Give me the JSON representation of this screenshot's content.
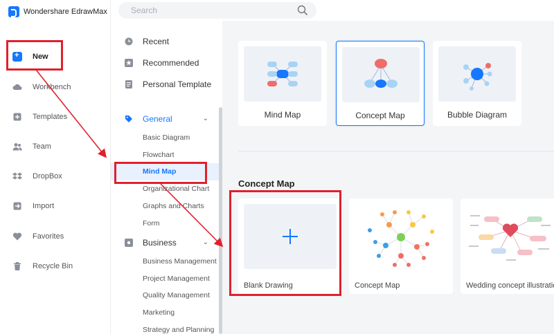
{
  "app": {
    "title": "Wondershare EdrawMax"
  },
  "search": {
    "placeholder": "Search"
  },
  "sidebar": {
    "items": [
      {
        "label": "New",
        "icon": "new-icon"
      },
      {
        "label": "Workbench",
        "icon": "cloud-icon"
      },
      {
        "label": "Templates",
        "icon": "templates-icon"
      },
      {
        "label": "Team",
        "icon": "team-icon"
      },
      {
        "label": "DropBox",
        "icon": "dropbox-icon"
      },
      {
        "label": "Import",
        "icon": "import-icon"
      },
      {
        "label": "Favorites",
        "icon": "heart-icon"
      },
      {
        "label": "Recycle Bin",
        "icon": "trash-icon"
      }
    ]
  },
  "middle": {
    "top_items": [
      {
        "label": "Recent",
        "icon": "clock-icon"
      },
      {
        "label": "Recommended",
        "icon": "star-icon"
      },
      {
        "label": "Personal Template",
        "icon": "document-icon"
      }
    ],
    "general": {
      "label": "General",
      "items": [
        "Basic Diagram",
        "Flowchart",
        "Mind Map",
        "Organizational Chart",
        "Graphs and Charts",
        "Form"
      ]
    },
    "business": {
      "label": "Business",
      "items": [
        "Business Management",
        "Project Management",
        "Quality Management",
        "Marketing",
        "Strategy and Planning"
      ]
    }
  },
  "diagram_types": [
    {
      "label": "Mind Map"
    },
    {
      "label": "Concept Map"
    },
    {
      "label": "Bubble Diagram"
    }
  ],
  "section": {
    "title": "Concept Map"
  },
  "templates": [
    {
      "label": "Blank Drawing"
    },
    {
      "label": "Concept Map"
    },
    {
      "label": "Wedding concept illustration"
    }
  ],
  "colors": {
    "accent": "#1677ff",
    "highlight": "#e0202c",
    "selected_bg": "#e8f1fd"
  }
}
